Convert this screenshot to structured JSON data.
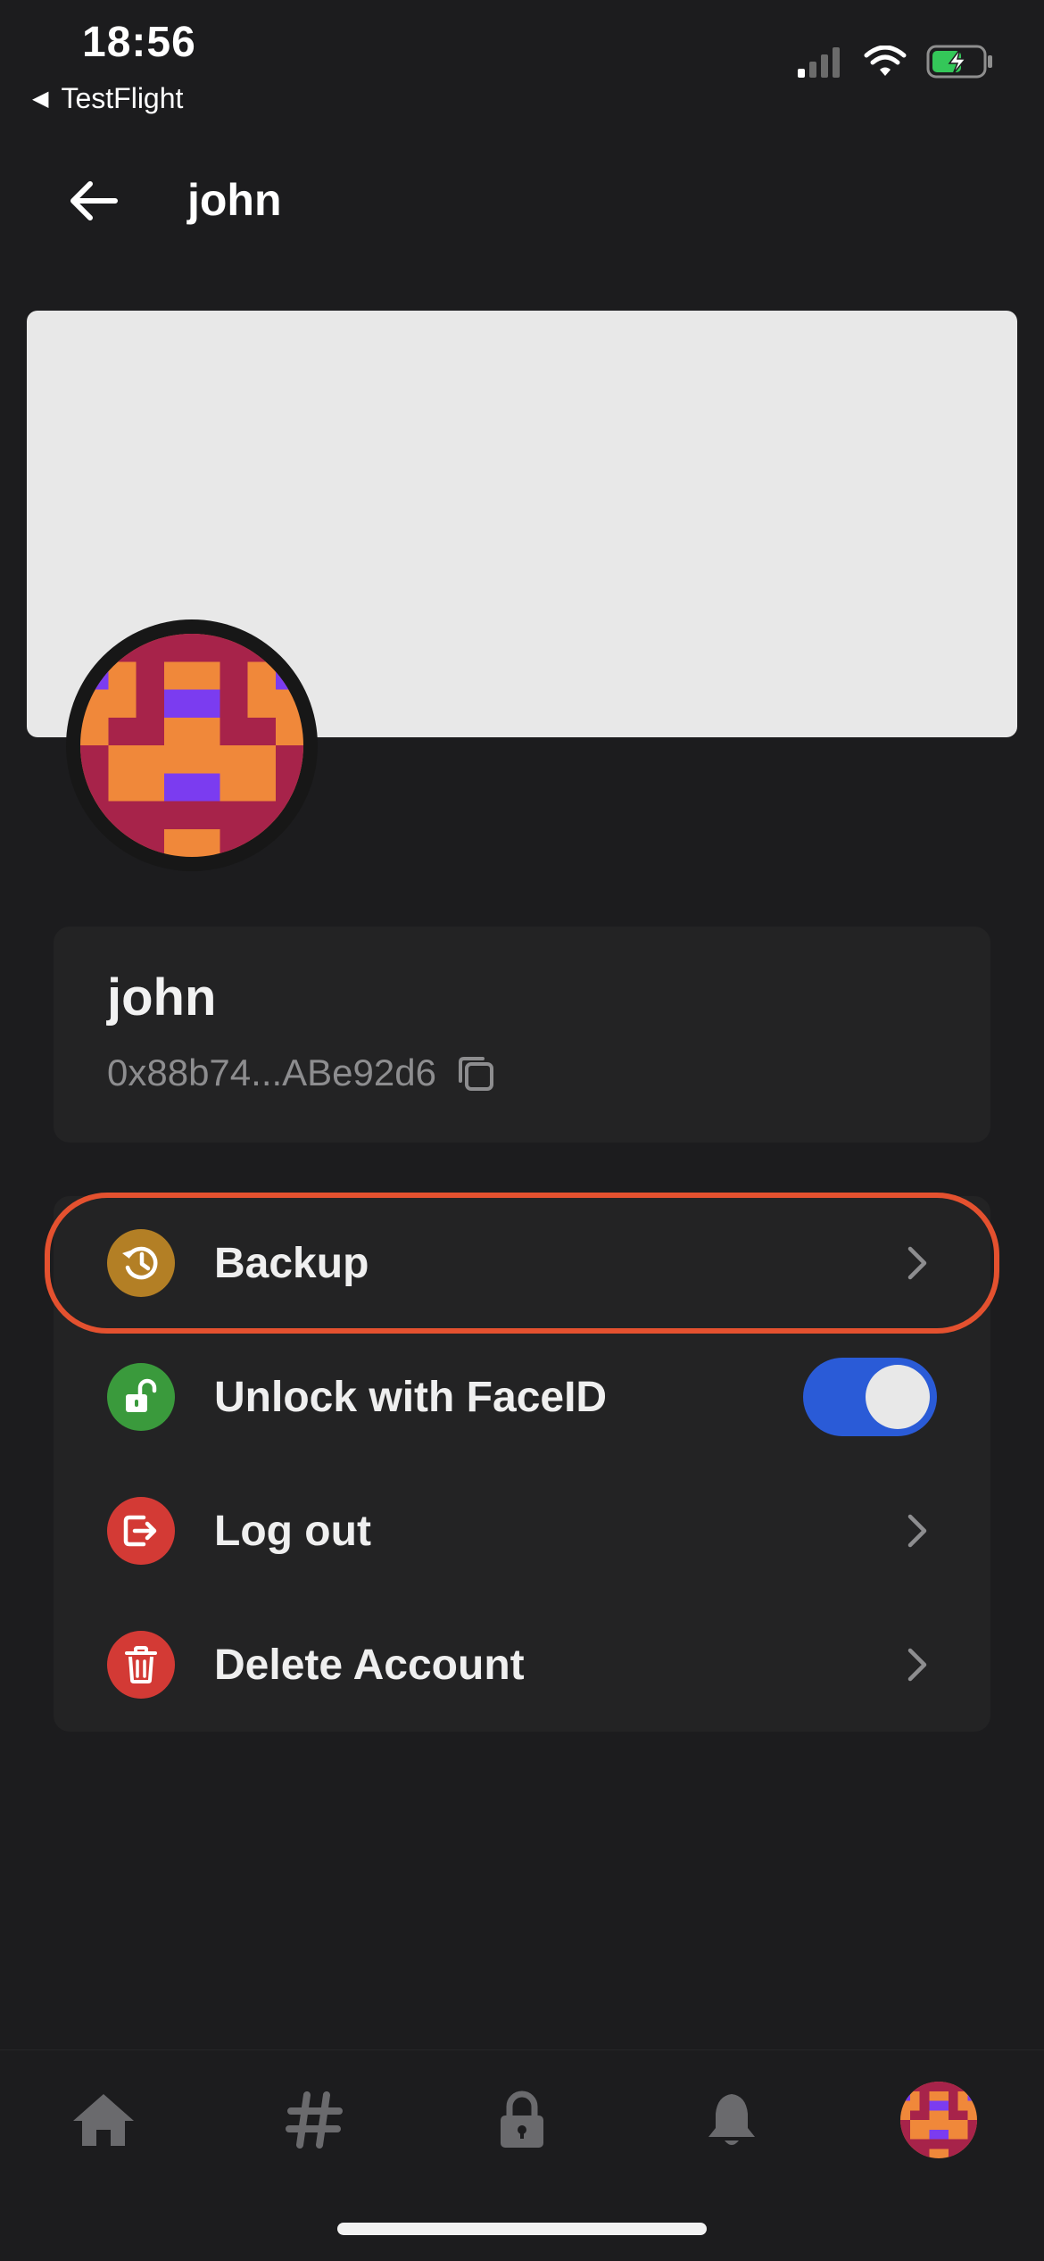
{
  "status_bar": {
    "time": "18:56",
    "back_app": "TestFlight"
  },
  "header": {
    "title": "john"
  },
  "profile": {
    "name": "john",
    "address": "0x88b74...ABe92d6"
  },
  "menu": {
    "items": [
      {
        "label": "Backup",
        "icon": "backup-history-icon",
        "color": "#b37f25"
      },
      {
        "label": "Unlock with FaceID",
        "icon": "unlock-icon",
        "color": "#3a9a3c",
        "toggle": true
      },
      {
        "label": "Log out",
        "icon": "logout-icon",
        "color": "#d33a35"
      },
      {
        "label": "Delete Account",
        "icon": "trash-icon",
        "color": "#d33a35"
      }
    ]
  },
  "bottom_nav": {
    "items": [
      "home-icon",
      "hashtag-icon",
      "lock-icon",
      "bell-icon",
      "profile-avatar"
    ]
  },
  "colors": {
    "background": "#1c1c1e",
    "card": "#232324",
    "highlight": "#e4512f",
    "toggle_on": "#2a5bd7",
    "avatar_orange": "#f0883a",
    "avatar_red": "#a7234a",
    "avatar_purple": "#7b3cf0"
  }
}
